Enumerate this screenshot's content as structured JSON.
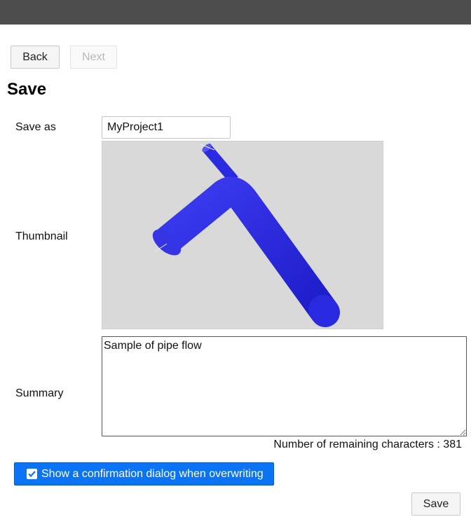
{
  "nav": {
    "back_label": "Back",
    "next_label": "Next"
  },
  "page": {
    "title": "Save"
  },
  "form": {
    "save_as_label": "Save as",
    "save_as_value": "MyProject1",
    "thumbnail_label": "Thumbnail",
    "summary_label": "Summary",
    "summary_value": "Sample of pipe flow",
    "remaining_text": "Number of remaining characters : 381",
    "confirm_label": "Show a confirmation dialog when overwriting",
    "confirm_checked": true,
    "save_label": "Save"
  },
  "colors": {
    "topbar": "#4d4d4d",
    "accent": "#0a74f5",
    "pipe": "#2a2ae0",
    "thumbnail_bg": "#d9d9d9"
  }
}
